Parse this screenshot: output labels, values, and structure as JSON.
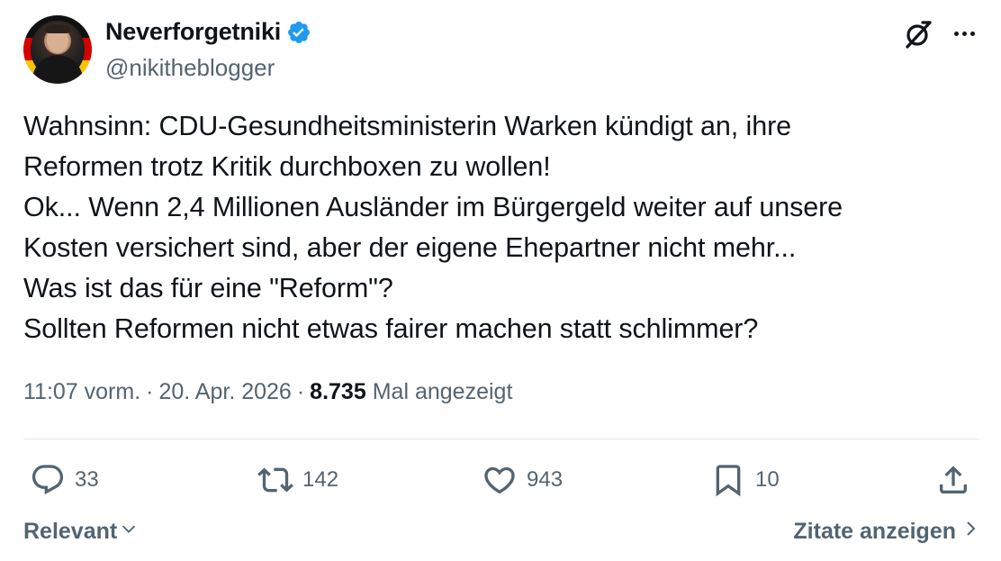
{
  "author": {
    "display_name": "Neverforgetniki",
    "handle": "@nikitheblogger",
    "verified": true,
    "verified_color": "#1d9bf0"
  },
  "tweet": {
    "lines": [
      "Wahnsinn: CDU-Gesundheitsministerin Warken kündigt an, ihre",
      "Reformen trotz Kritik durchboxen zu wollen!",
      "Ok... Wenn 2,4 Millionen Ausländer im Bürgergeld weiter auf unsere",
      "Kosten versichert sind, aber der eigene Ehepartner nicht mehr...",
      "Was ist das für eine \"Reform\"?",
      "Sollten Reformen nicht etwas fairer machen statt schlimmer?"
    ]
  },
  "meta": {
    "time": "11:07 vorm.",
    "separator": "·",
    "date": "20. Apr. 2026",
    "views_count": "8.735",
    "views_label": "Mal angezeigt"
  },
  "actions": {
    "replies": "33",
    "retweets": "142",
    "likes": "943",
    "bookmarks": "10"
  },
  "footer": {
    "sort_label": "Relevant",
    "quotes_label": "Zitate anzeigen"
  },
  "colors": {
    "text_primary": "#0f1419",
    "text_secondary": "#536471",
    "divider": "#e6e9eb"
  },
  "icons": {
    "header": [
      "grok-icon",
      "more-icon"
    ],
    "actions": [
      "reply-icon",
      "retweet-icon",
      "like-icon",
      "bookmark-icon",
      "share-icon"
    ]
  }
}
